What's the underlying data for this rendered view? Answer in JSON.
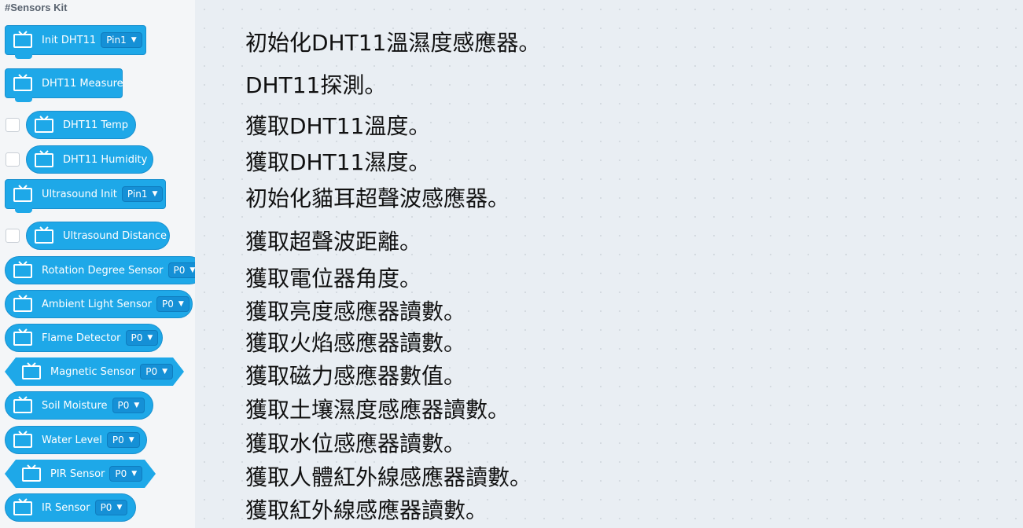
{
  "category": "#Sensors Kit",
  "blocks": {
    "init_dht11": {
      "label": "Init DHT11",
      "option": "Pin1"
    },
    "dht11_measure": {
      "label": "DHT11 Measure"
    },
    "dht11_temp": {
      "label": "DHT11 Temp"
    },
    "dht11_humidity": {
      "label": "DHT11 Humidity"
    },
    "ultrasound_init": {
      "label": "Ultrasound Init",
      "option": "Pin1"
    },
    "ultrasound_distance": {
      "label": "Ultrasound Distance"
    },
    "rotation": {
      "label": "Rotation Degree Sensor",
      "option": "P0"
    },
    "ambient": {
      "label": "Ambient Light Sensor",
      "option": "P0"
    },
    "flame": {
      "label": "Flame Detector",
      "option": "P0"
    },
    "magnetic": {
      "label": "Magnetic Sensor",
      "option": "P0"
    },
    "soil": {
      "label": "Soil Moisture",
      "option": "P0"
    },
    "water": {
      "label": "Water Level",
      "option": "P0"
    },
    "pir": {
      "label": "PIR Sensor",
      "option": "P0"
    },
    "ir": {
      "label": "IR Sensor",
      "option": "P0"
    }
  },
  "descriptions": [
    "初始化DHT11溫濕度感應器。",
    "DHT11探測。",
    "獲取DHT11溫度。",
    "獲取DHT11濕度。",
    "初始化貓耳超聲波感應器。",
    "獲取超聲波距離。",
    "獲取電位器角度。",
    "獲取亮度感應器讀數。",
    "獲取火焰感應器讀數。",
    "獲取磁力感應器數值。",
    "獲取土壤濕度感應器讀數。",
    "獲取水位感應器讀數。",
    "獲取人體紅外線感應器讀數。",
    "獲取紅外線感應器讀數。"
  ],
  "colors": {
    "block": "#1ea8e8",
    "dropdown": "#1590d6",
    "workspace": "#e9eef3",
    "toolbox": "#f4f6f8"
  }
}
